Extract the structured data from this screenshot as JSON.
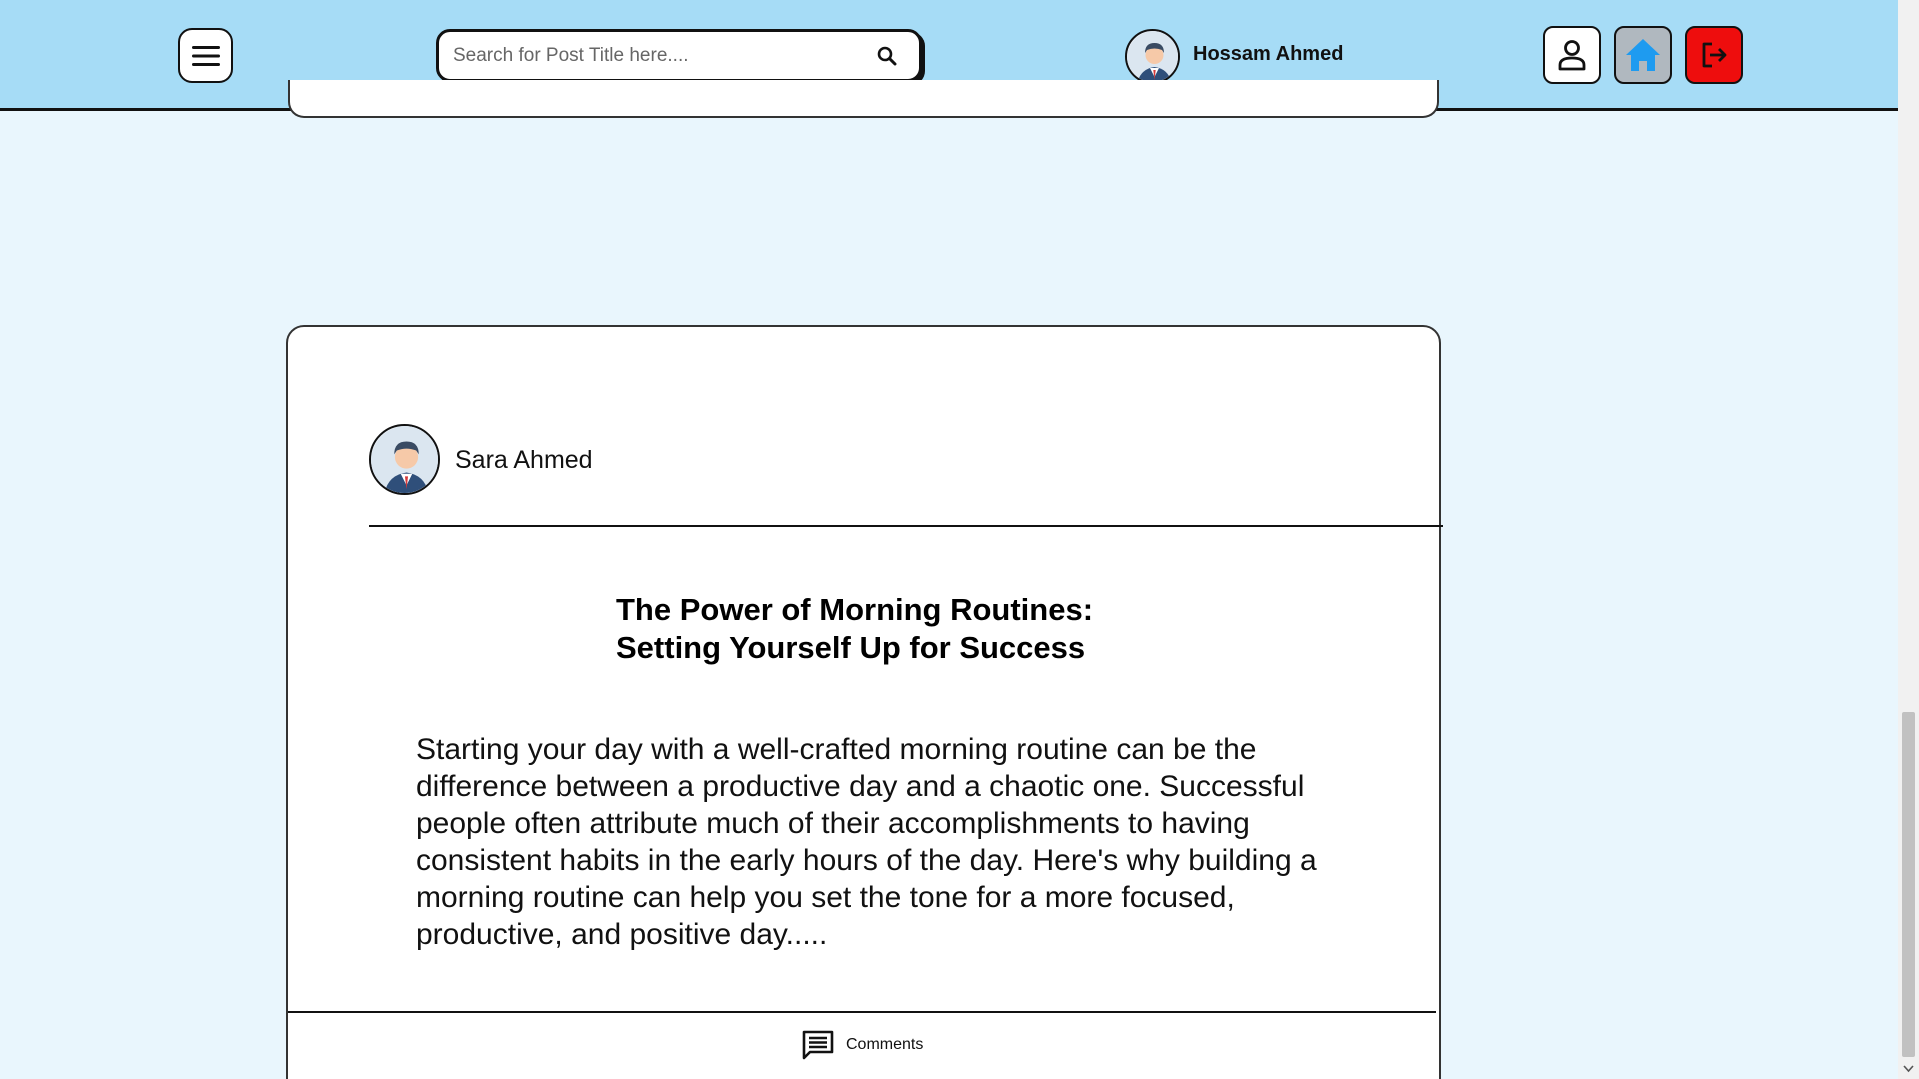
{
  "header": {
    "search": {
      "placeholder": "Search for Post Title here...."
    },
    "user": {
      "name": "Hossam Ahmed"
    }
  },
  "post": {
    "author": "Sara Ahmed",
    "title_line1": "The Power of Morning Routines:",
    "title_line2": "Setting Yourself Up for Success",
    "body": "Starting your day with a well-crafted morning routine can be the difference between a productive day and a chaotic one. Successful people often attribute much of their accomplishments to having consistent habits in the early hours of the day. Here's why building a morning routine can help you set the tone for a more focused, productive, and positive day.....",
    "comments_label": "Comments"
  },
  "colors": {
    "header_bg": "#a6dcf6",
    "page_bg": "#e9f6fd",
    "home_btn": "#b0b8bf",
    "home_icon": "#1e9bf0",
    "logout_btn": "#ee0d0d"
  },
  "icons": [
    "menu-icon",
    "search-icon",
    "profile-icon",
    "home-icon",
    "logout-icon",
    "comment-icon"
  ]
}
